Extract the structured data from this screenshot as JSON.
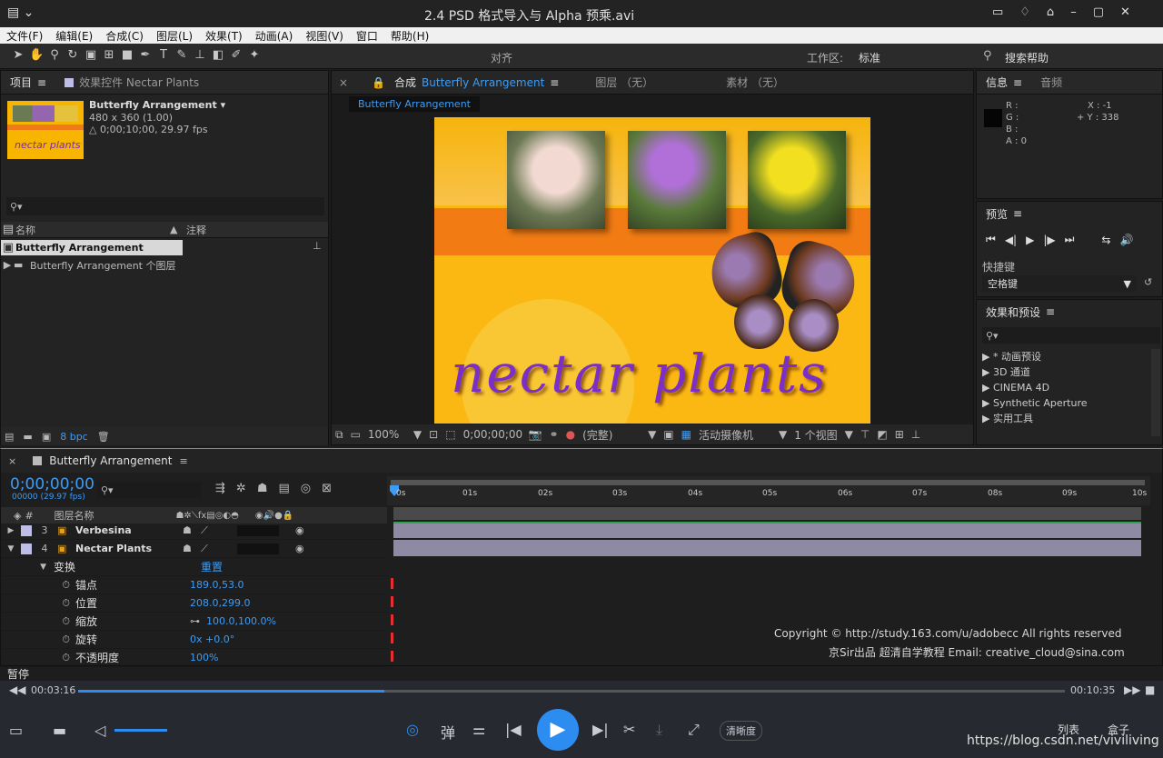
{
  "window": {
    "title": "2.4 PSD 格式导入与 Alpha 预乘.avi"
  },
  "menu": [
    "文件(F)",
    "编辑(E)",
    "合成(C)",
    "图层(L)",
    "效果(T)",
    "动画(A)",
    "视图(V)",
    "窗口",
    "帮助(H)"
  ],
  "toolbar": {
    "snap_label": "对齐",
    "workspace_label": "工作区:",
    "workspace_value": "标准",
    "search_help": "搜索帮助"
  },
  "project": {
    "tab": "项目",
    "effects_tab": "效果控件 Nectar Plants",
    "item_name": "Butterfly Arrangement ▾",
    "item_size": "480 x 360 (1.00)",
    "item_duration": "△ 0;00;10;00, 29.97 fps",
    "col_name": "名称",
    "col_comment": "注释",
    "items": [
      "Butterfly Arrangement",
      "Butterfly Arrangement 个图层"
    ],
    "bpc": "8 bpc"
  },
  "comp": {
    "tab_prefix": "合成",
    "tab_name": "Butterfly Arrangement",
    "layer_tab": "图层 （无）",
    "footage_tab": "素材 （无）",
    "subtab": "Butterfly Arrangement",
    "zoom": "100%",
    "timecode": "0;00;00;00",
    "quality": "(完整)",
    "camera": "活动摄像机",
    "views": "1 个视图"
  },
  "artwork": {
    "title": "nectar plants"
  },
  "info": {
    "tab": "信息",
    "audio_tab": "音频",
    "r": "R :",
    "g": "G :",
    "b": "B :",
    "a": "A : 0",
    "x": "X : -1",
    "y": "+ Y : 338"
  },
  "preview": {
    "tab": "预览",
    "shortcut_label": "快捷键",
    "shortcut_value": "空格键"
  },
  "effects": {
    "tab": "效果和预设",
    "items": [
      "▶ * 动画预设",
      "▶ 3D 通道",
      "▶ CINEMA 4D",
      "▶ Synthetic Aperture",
      "▶ 实用工具"
    ]
  },
  "timeline": {
    "tab": "Butterfly Arrangement",
    "timecode": "0;00;00;00",
    "fps": "00000 (29.97 fps)",
    "col_num": "#",
    "col_name": "图层名称",
    "ruler": [
      "0s",
      "01s",
      "02s",
      "03s",
      "04s",
      "05s",
      "06s",
      "07s",
      "08s",
      "09s",
      "10s"
    ],
    "layers": [
      {
        "num": "3",
        "name": "Verbesina"
      },
      {
        "num": "4",
        "name": "Nectar Plants"
      }
    ],
    "transform": {
      "label": "变换",
      "reset": "重置"
    },
    "props": [
      {
        "name": "锚点",
        "value": "189.0,53.0"
      },
      {
        "name": "位置",
        "value": "208.0,299.0"
      },
      {
        "name": "缩放",
        "value": "100.0,100.0%"
      },
      {
        "name": "旋转",
        "value": "0x +0.0°"
      },
      {
        "name": "不透明度",
        "value": "100%"
      }
    ]
  },
  "watermark": {
    "line1": "Copyright © http://study.163.com/u/adobecc All rights reserved",
    "line2": "京Sir出品  超清自学教程 Email: creative_cloud@sina.com"
  },
  "player": {
    "status": "暂停",
    "current": "00:03:16",
    "total": "00:10:35",
    "progress": 0.31,
    "danmaku": "弹",
    "quality": "清晰度",
    "list": "列表",
    "box": "盒子",
    "url": "https://blog.csdn.net/viviliving"
  },
  "colors": {
    "accent": "#3d9cf5",
    "timeline_bar": "#8f8aa3",
    "keyframe": "#e03030"
  }
}
